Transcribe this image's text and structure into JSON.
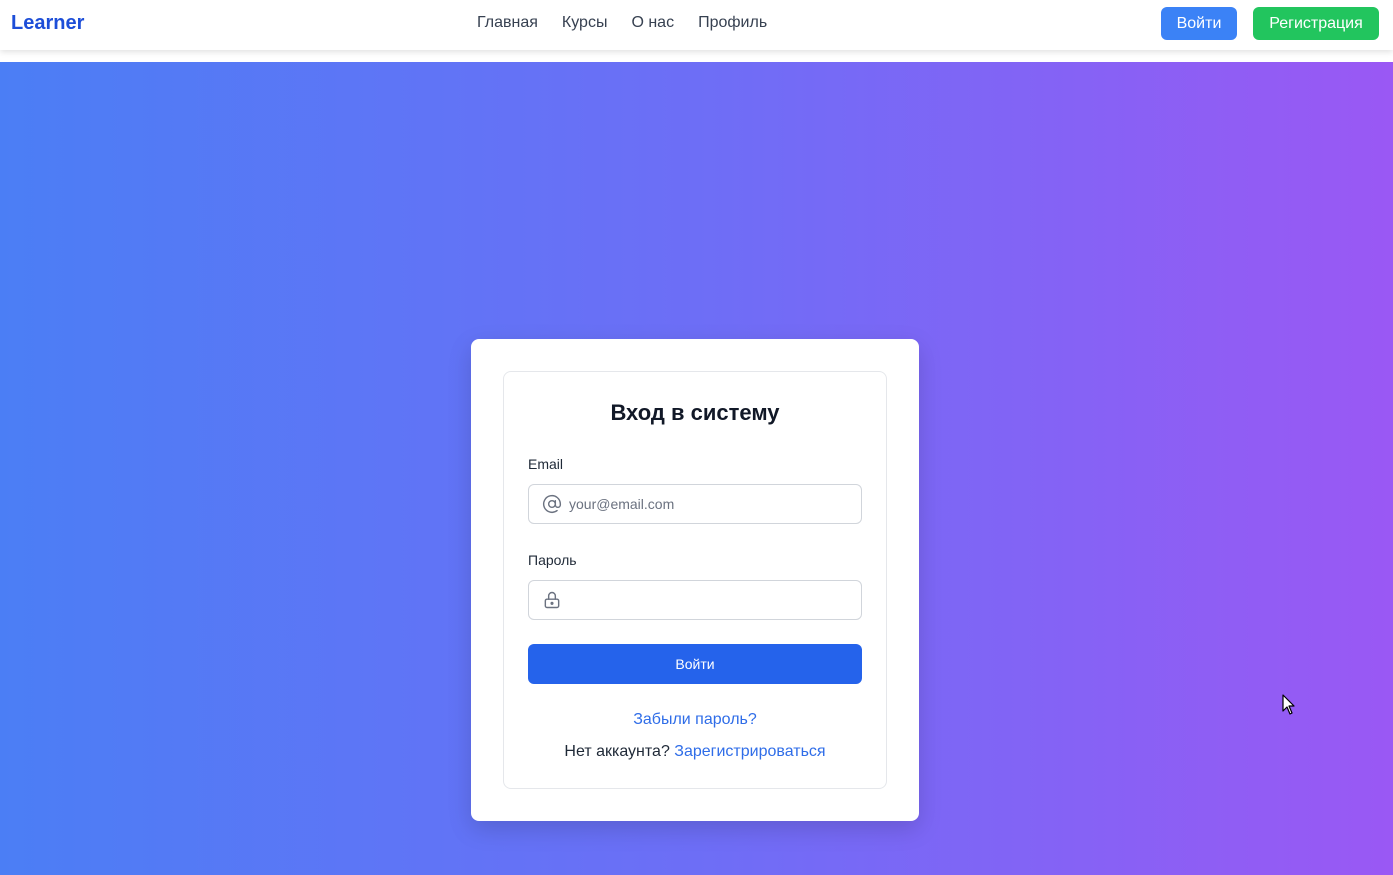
{
  "header": {
    "logo": "Learner",
    "nav": [
      {
        "label": "Главная"
      },
      {
        "label": "Курсы"
      },
      {
        "label": "О нас"
      },
      {
        "label": "Профиль"
      }
    ],
    "login_label": "Войти",
    "register_label": "Регистрация"
  },
  "form": {
    "title": "Вход в систему",
    "email_label": "Email",
    "email_placeholder": "your@email.com",
    "email_value": "",
    "email_icon": "at-sign-icon",
    "password_label": "Пароль",
    "password_value": "",
    "password_icon": "lock-icon",
    "submit_label": "Войти",
    "forgot_link": "Забыли пароль?",
    "no_account_text": "Нет аккаунта?",
    "register_link": "Зарегистрироваться"
  },
  "colors": {
    "brand": "#1d4ed8",
    "login_button": "#3b82f6",
    "register_button": "#22c55e",
    "submit_button": "#2563eb",
    "link": "#2f6de8",
    "gradient_start": "#4b7ef5",
    "gradient_end": "#9a58f4"
  }
}
